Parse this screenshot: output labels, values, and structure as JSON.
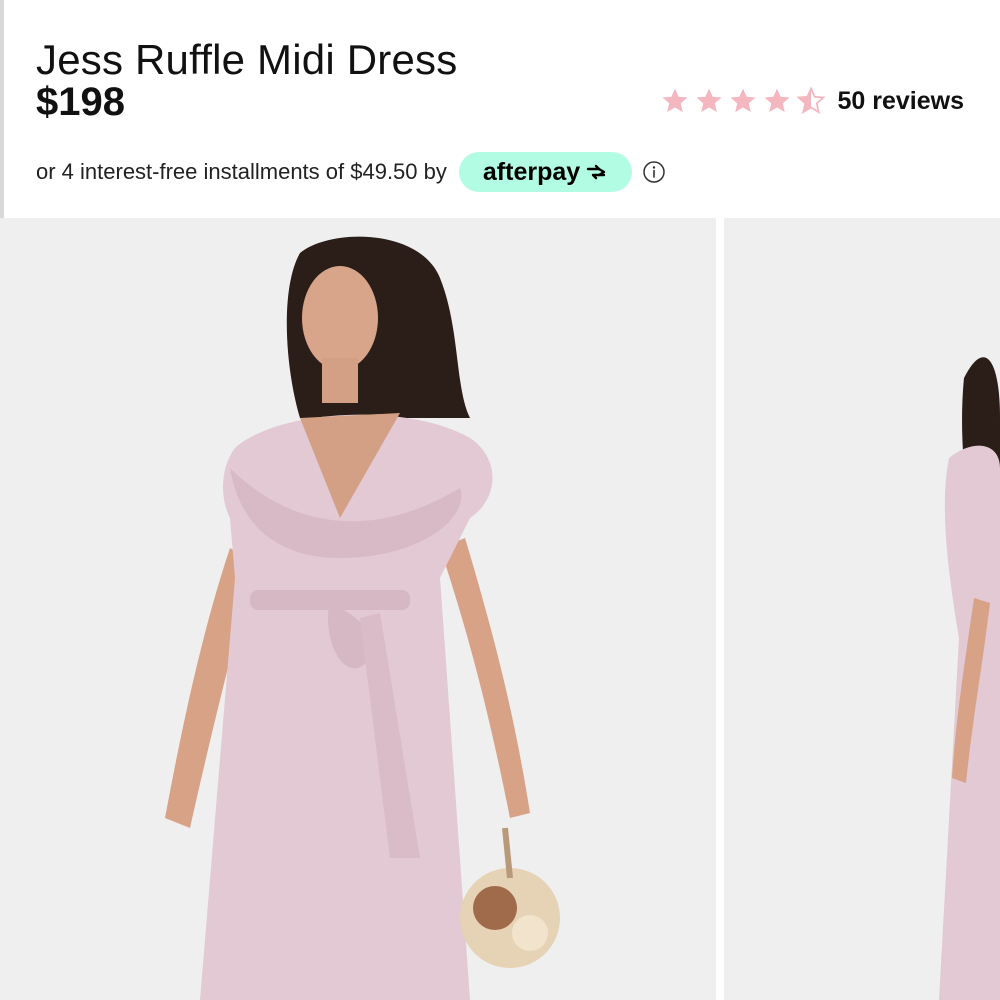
{
  "product": {
    "title": "Jess Ruffle Midi Dress",
    "price": "$198"
  },
  "rating": {
    "value_out_of_5": 4.5,
    "reviews_label": "50 reviews",
    "star_color": "#f5b7bf"
  },
  "payment": {
    "installments_text": "or 4 interest-free installments of $49.50 by",
    "afterpay_label": "afterpay",
    "afterpay_color": "#b2fce4"
  },
  "gallery": {
    "images": [
      {
        "icon": "product-photo-dress-front"
      },
      {
        "icon": "product-photo-dress-side"
      }
    ],
    "dress_color": "#e2c9d3",
    "background_color": "#efefef"
  }
}
